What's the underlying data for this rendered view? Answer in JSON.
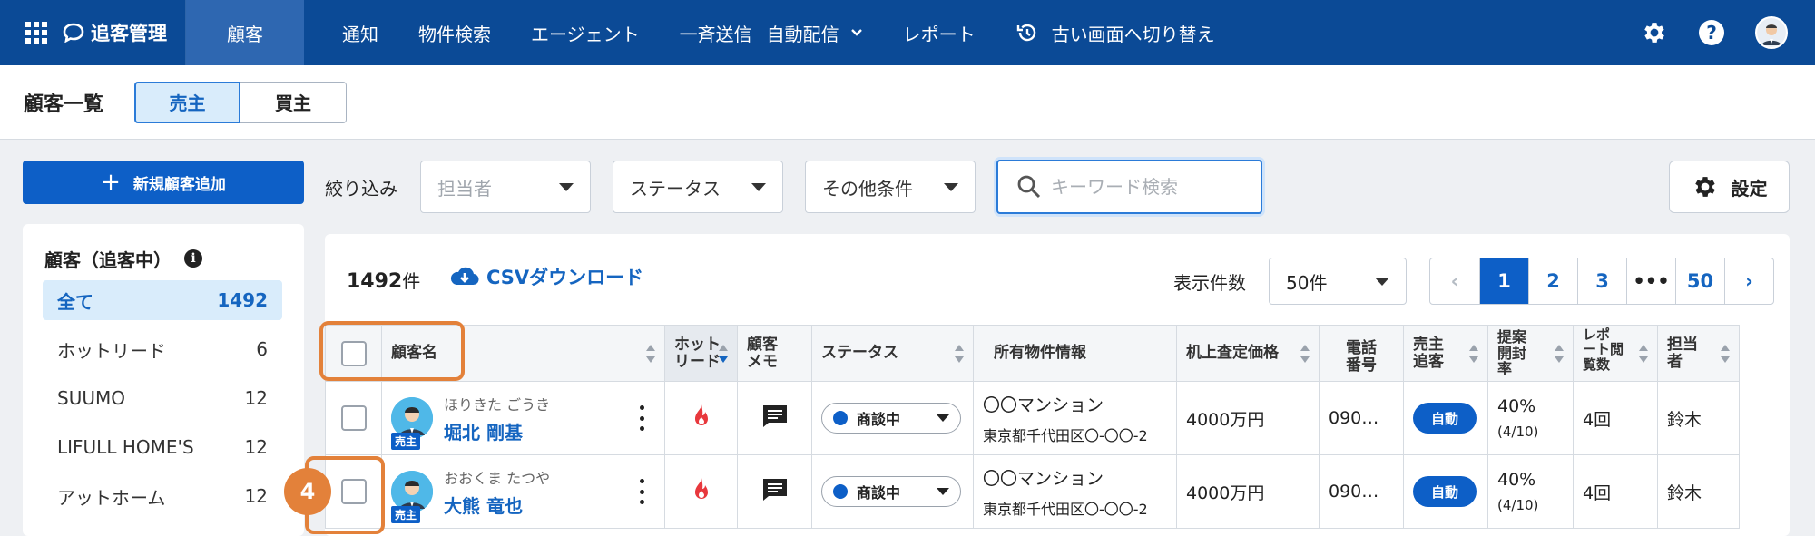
{
  "nav": {
    "brand": "追客管理",
    "items": [
      "顧客",
      "通知",
      "物件検索",
      "エージェント",
      "一斉送信",
      "自動配信",
      "レポート",
      "古い画面へ切り替え"
    ],
    "help": "?"
  },
  "subheader": {
    "title": "顧客一覧",
    "seg_seller": "売主",
    "seg_buyer": "買主"
  },
  "toolbar": {
    "new_customer": "新規顧客追加",
    "filter_label": "絞り込み",
    "assignee": "担当者",
    "status": "ステータス",
    "other": "その他条件",
    "search_placeholder": "キーワード検索",
    "settings": "設定"
  },
  "sidebar": {
    "title": "顧客（追客中）",
    "items": [
      {
        "label": "全て",
        "count": "1492"
      },
      {
        "label": "ホットリード",
        "count": "6"
      },
      {
        "label": "SUUMO",
        "count": "12"
      },
      {
        "label": "LIFULL HOME'S",
        "count": "12"
      },
      {
        "label": "アットホーム",
        "count": "12"
      }
    ]
  },
  "list": {
    "count": "1492",
    "count_unit": "件",
    "csv": "CSVダウンロード",
    "per_page_label": "表示件数",
    "per_page": "50件",
    "pages": [
      "‹",
      "1",
      "2",
      "3",
      "•••",
      "50",
      "›"
    ]
  },
  "table": {
    "headers": {
      "name": "顧客名",
      "hot": "ホット\nリード",
      "memo": "顧客\nメモ",
      "status": "ステータス",
      "property": "所有物件情報",
      "price": "机上査定価格",
      "phone": "電話\n番号",
      "follow": "売主\n追客",
      "rate": "提案\n開封\n率",
      "report": "レポ\nート閲\n覧数",
      "agent": "担当\n者"
    },
    "rows": [
      {
        "kana": "ほりきた ごうき",
        "name": "堀北 剛基",
        "badge": "売主",
        "status": "商談中",
        "prop1": "〇〇マンション",
        "prop2": "東京都千代田区〇-〇〇-2",
        "price": "4000万円",
        "phone": "090…",
        "follow": "自動",
        "rate1": "40%",
        "rate2": "(4/10)",
        "report": "4回",
        "agent": "鈴木"
      },
      {
        "kana": "おおくま たつや",
        "name": "大熊 竜也",
        "badge": "売主",
        "status": "商談中",
        "prop1": "〇〇マンション",
        "prop2": "東京都千代田区〇-〇〇-2",
        "price": "4000万円",
        "phone": "090…",
        "follow": "自動",
        "rate1": "40%",
        "rate2": "(4/10)",
        "report": "4回",
        "agent": "鈴木"
      }
    ]
  },
  "step_number": "4",
  "colors": {
    "nav_bg": "#0b4a96",
    "primary": "#0d5fc7",
    "highlight": "#e3813a",
    "hot": "#e8383d"
  }
}
